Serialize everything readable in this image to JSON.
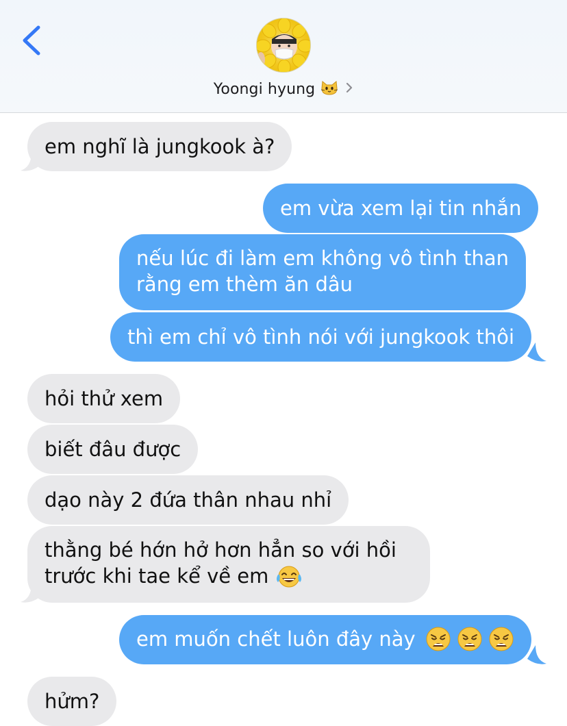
{
  "header": {
    "contact_name": "Yoongi hyung",
    "contact_emoji": "cat-face",
    "back_icon": "chevron-left-icon",
    "disclosure_icon": "chevron-right-icon"
  },
  "messages": [
    {
      "from": "them",
      "text": "em nghĩ là jungkook à?"
    },
    {
      "from": "me",
      "text": "em vừa xem lại tin nhắn"
    },
    {
      "from": "me",
      "lines": [
        "nếu lúc đi làm em không vô tình than",
        "rằng em thèm ăn dâu"
      ]
    },
    {
      "from": "me",
      "text": "thì em chỉ vô tình nói với jungkook thôi"
    },
    {
      "from": "them",
      "text": "hỏi thử xem"
    },
    {
      "from": "them",
      "text": "biết đâu được"
    },
    {
      "from": "them",
      "text": "dạo này 2 đứa thân nhau nhỉ"
    },
    {
      "from": "them",
      "lines": [
        "thằng bé hớn hở hơn hẳn so với hồi",
        "trước khi tae kể về em"
      ],
      "emoji": [
        "face-with-tears-of-joy"
      ]
    },
    {
      "from": "me",
      "text": "em muốn chết luôn đây này",
      "emoji": [
        "weary-face",
        "weary-face",
        "weary-face"
      ]
    },
    {
      "from": "them",
      "text": "hửm?"
    }
  ],
  "colors": {
    "sent_bubble": "#57a8f6",
    "received_bubble": "#e9e9eb",
    "accent": "#3478f6"
  }
}
